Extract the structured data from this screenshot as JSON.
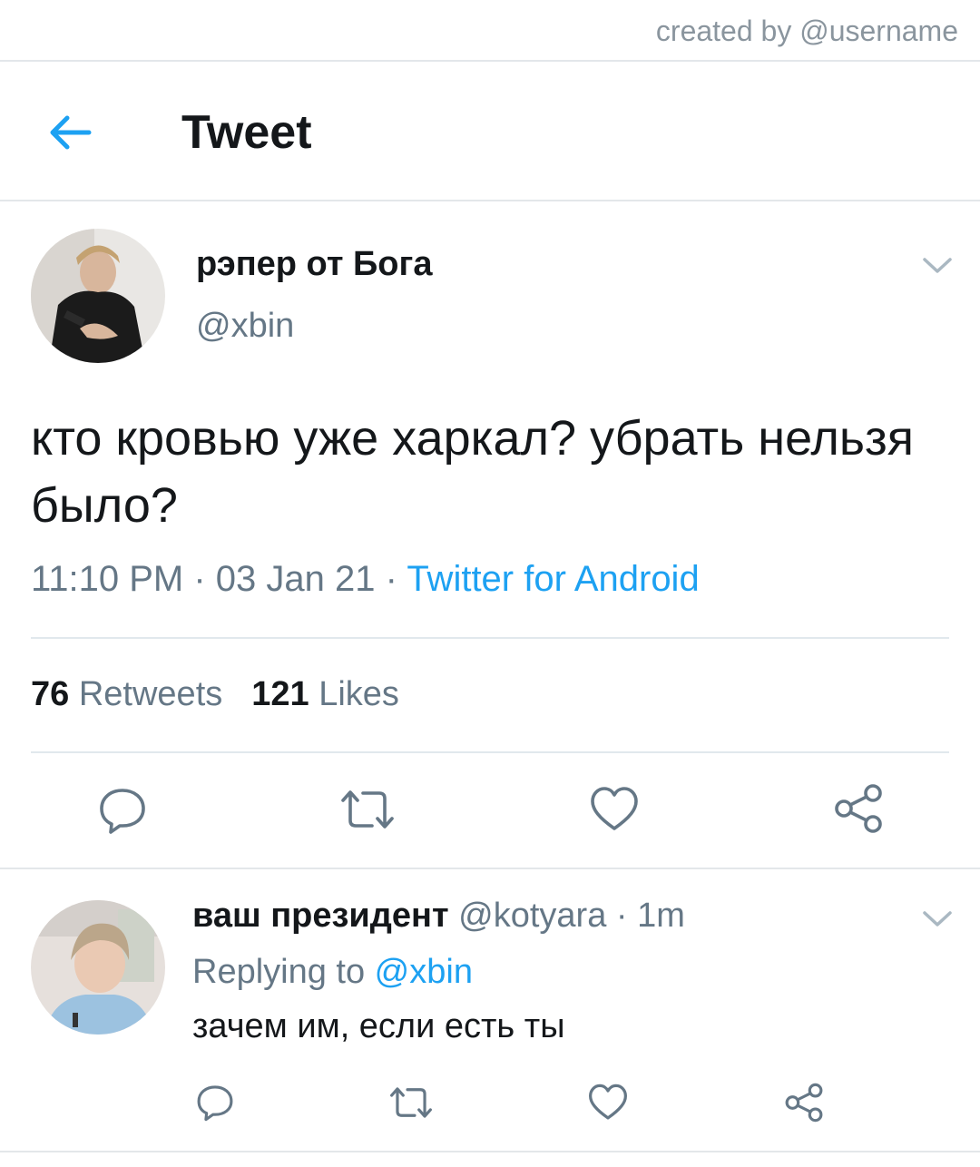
{
  "credit": "created by @username",
  "header": {
    "title": "Tweet",
    "back_icon": "arrow-left-icon"
  },
  "tweet": {
    "author_name": "рэпер от Бога",
    "author_handle": "@xbin",
    "text": "кто кровью уже харкал? убрать нельзя было?",
    "time": "11:10 PM",
    "separator1": " · ",
    "date": "03 Jan 21",
    "separator2": " · ",
    "source": "Twitter for Android",
    "retweets_count": "76",
    "retweets_label": "Retweets",
    "likes_count": "121",
    "likes_label": "Likes"
  },
  "reply": {
    "author_name": "ваш президент",
    "author_handle": "@kotyara",
    "separator": " · ",
    "time": "1m",
    "replying_prefix": "Replying to ",
    "replying_to": "@xbin",
    "text": "зачем им, если есть ты"
  },
  "colors": {
    "accent": "#1da1f2",
    "text": "#14171a",
    "secondary": "#657786",
    "divider": "#e1e8ed"
  },
  "icons": [
    "arrow-left-icon",
    "chevron-down-icon",
    "reply-icon",
    "retweet-icon",
    "like-icon",
    "share-icon"
  ]
}
